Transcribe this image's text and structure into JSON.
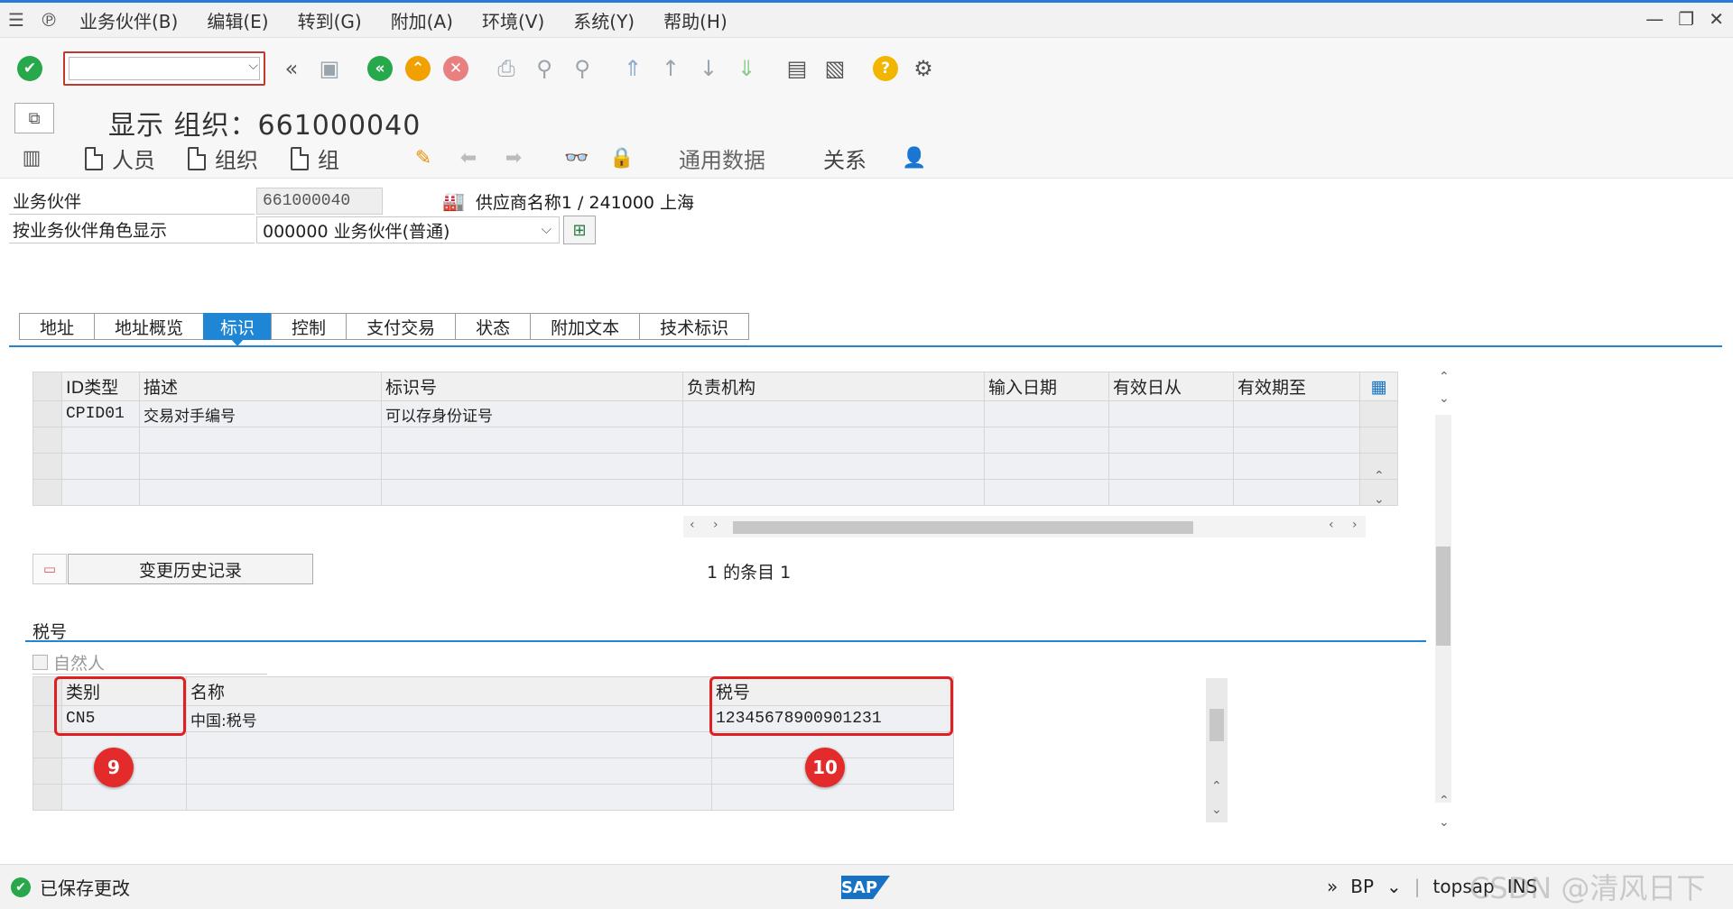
{
  "menubar": {
    "items": [
      "业务伙伴(B)",
      "编辑(E)",
      "转到(G)",
      "附加(A)",
      "环境(V)",
      "系统(Y)",
      "帮助(H)"
    ]
  },
  "toolbar": {
    "command_value": ""
  },
  "title": {
    "text": "显示 组织：661000040"
  },
  "app_toolbar": {
    "person": "人员",
    "org": "组织",
    "group": "组",
    "general_data": "通用数据",
    "relations": "关系"
  },
  "header": {
    "bp_label": "业务伙伴",
    "bp_value": "661000040",
    "bp_desc": "供应商名称1 / 241000 上海",
    "role_label": "按业务伙伴角色显示",
    "role_value": "000000 业务伙伴(普通)"
  },
  "tabs": [
    "地址",
    "地址概览",
    "标识",
    "控制",
    "支付交易",
    "状态",
    "附加文本",
    "技术标识"
  ],
  "active_tab": "标识",
  "id_table": {
    "columns": [
      "ID类型",
      "描述",
      "标识号",
      "负责机构",
      "输入日期",
      "有效日从",
      "有效期至"
    ],
    "rows": [
      [
        "CPID01",
        "交易对手编号",
        "可以存身份证号",
        "",
        "",
        "",
        ""
      ]
    ]
  },
  "history_button": "变更历史记录",
  "entries_text": "1 的条目 1",
  "tax_section": {
    "title": "税号",
    "natural_person_label": "自然人",
    "columns": [
      "类别",
      "名称",
      "税号"
    ],
    "rows": [
      [
        "CN5",
        "中国:税号",
        "12345678900901231"
      ]
    ]
  },
  "badges": {
    "b9": "9",
    "b10": "10"
  },
  "statusbar": {
    "message": "已保存更改",
    "sap": "SAP",
    "tcode": "BP",
    "server": "topsap",
    "mode": "INS"
  },
  "watermark": "CSDN @清风日下",
  "colors": {
    "accent": "#1f86d6",
    "highlight": "#e02020",
    "success": "#27a84a"
  }
}
